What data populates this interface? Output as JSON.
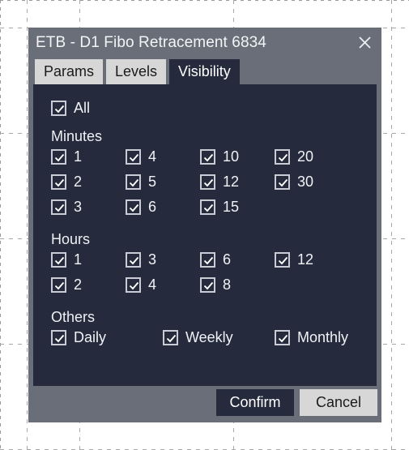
{
  "window": {
    "title": "ETB - D1 Fibo Retracement 6834",
    "close_icon": "close-icon"
  },
  "tabs": [
    {
      "label": "Params",
      "active": false
    },
    {
      "label": "Levels",
      "active": false
    },
    {
      "label": "Visibility",
      "active": true
    }
  ],
  "visibility": {
    "all": {
      "label": "All",
      "checked": true
    },
    "sections": [
      {
        "name": "Minutes",
        "label": "Minutes",
        "columns": [
          [
            {
              "label": "1",
              "checked": true
            },
            {
              "label": "2",
              "checked": true
            },
            {
              "label": "3",
              "checked": true
            }
          ],
          [
            {
              "label": "4",
              "checked": true
            },
            {
              "label": "5",
              "checked": true
            },
            {
              "label": "6",
              "checked": true
            }
          ],
          [
            {
              "label": "10",
              "checked": true
            },
            {
              "label": "12",
              "checked": true
            },
            {
              "label": "15",
              "checked": true
            }
          ],
          [
            {
              "label": "20",
              "checked": true
            },
            {
              "label": "30",
              "checked": true
            }
          ]
        ]
      },
      {
        "name": "Hours",
        "label": "Hours",
        "columns": [
          [
            {
              "label": "1",
              "checked": true
            },
            {
              "label": "2",
              "checked": true
            }
          ],
          [
            {
              "label": "3",
              "checked": true
            },
            {
              "label": "4",
              "checked": true
            }
          ],
          [
            {
              "label": "6",
              "checked": true
            },
            {
              "label": "8",
              "checked": true
            }
          ],
          [
            {
              "label": "12",
              "checked": true
            }
          ]
        ]
      },
      {
        "name": "Others",
        "label": "Others",
        "columns": [
          [
            {
              "label": "Daily",
              "checked": true
            }
          ],
          [
            {
              "label": "Weekly",
              "checked": true
            }
          ],
          [
            {
              "label": "Monthly",
              "checked": true
            }
          ]
        ]
      }
    ]
  },
  "footer": {
    "confirm_label": "Confirm",
    "cancel_label": "Cancel"
  },
  "colors": {
    "chrome_gray": "#6a6e79",
    "panel_dark": "#252b3d",
    "tab_inactive": "#d7d7d7",
    "text_light": "#f0f2f6",
    "checkbox_border": "#c9ccd4"
  }
}
